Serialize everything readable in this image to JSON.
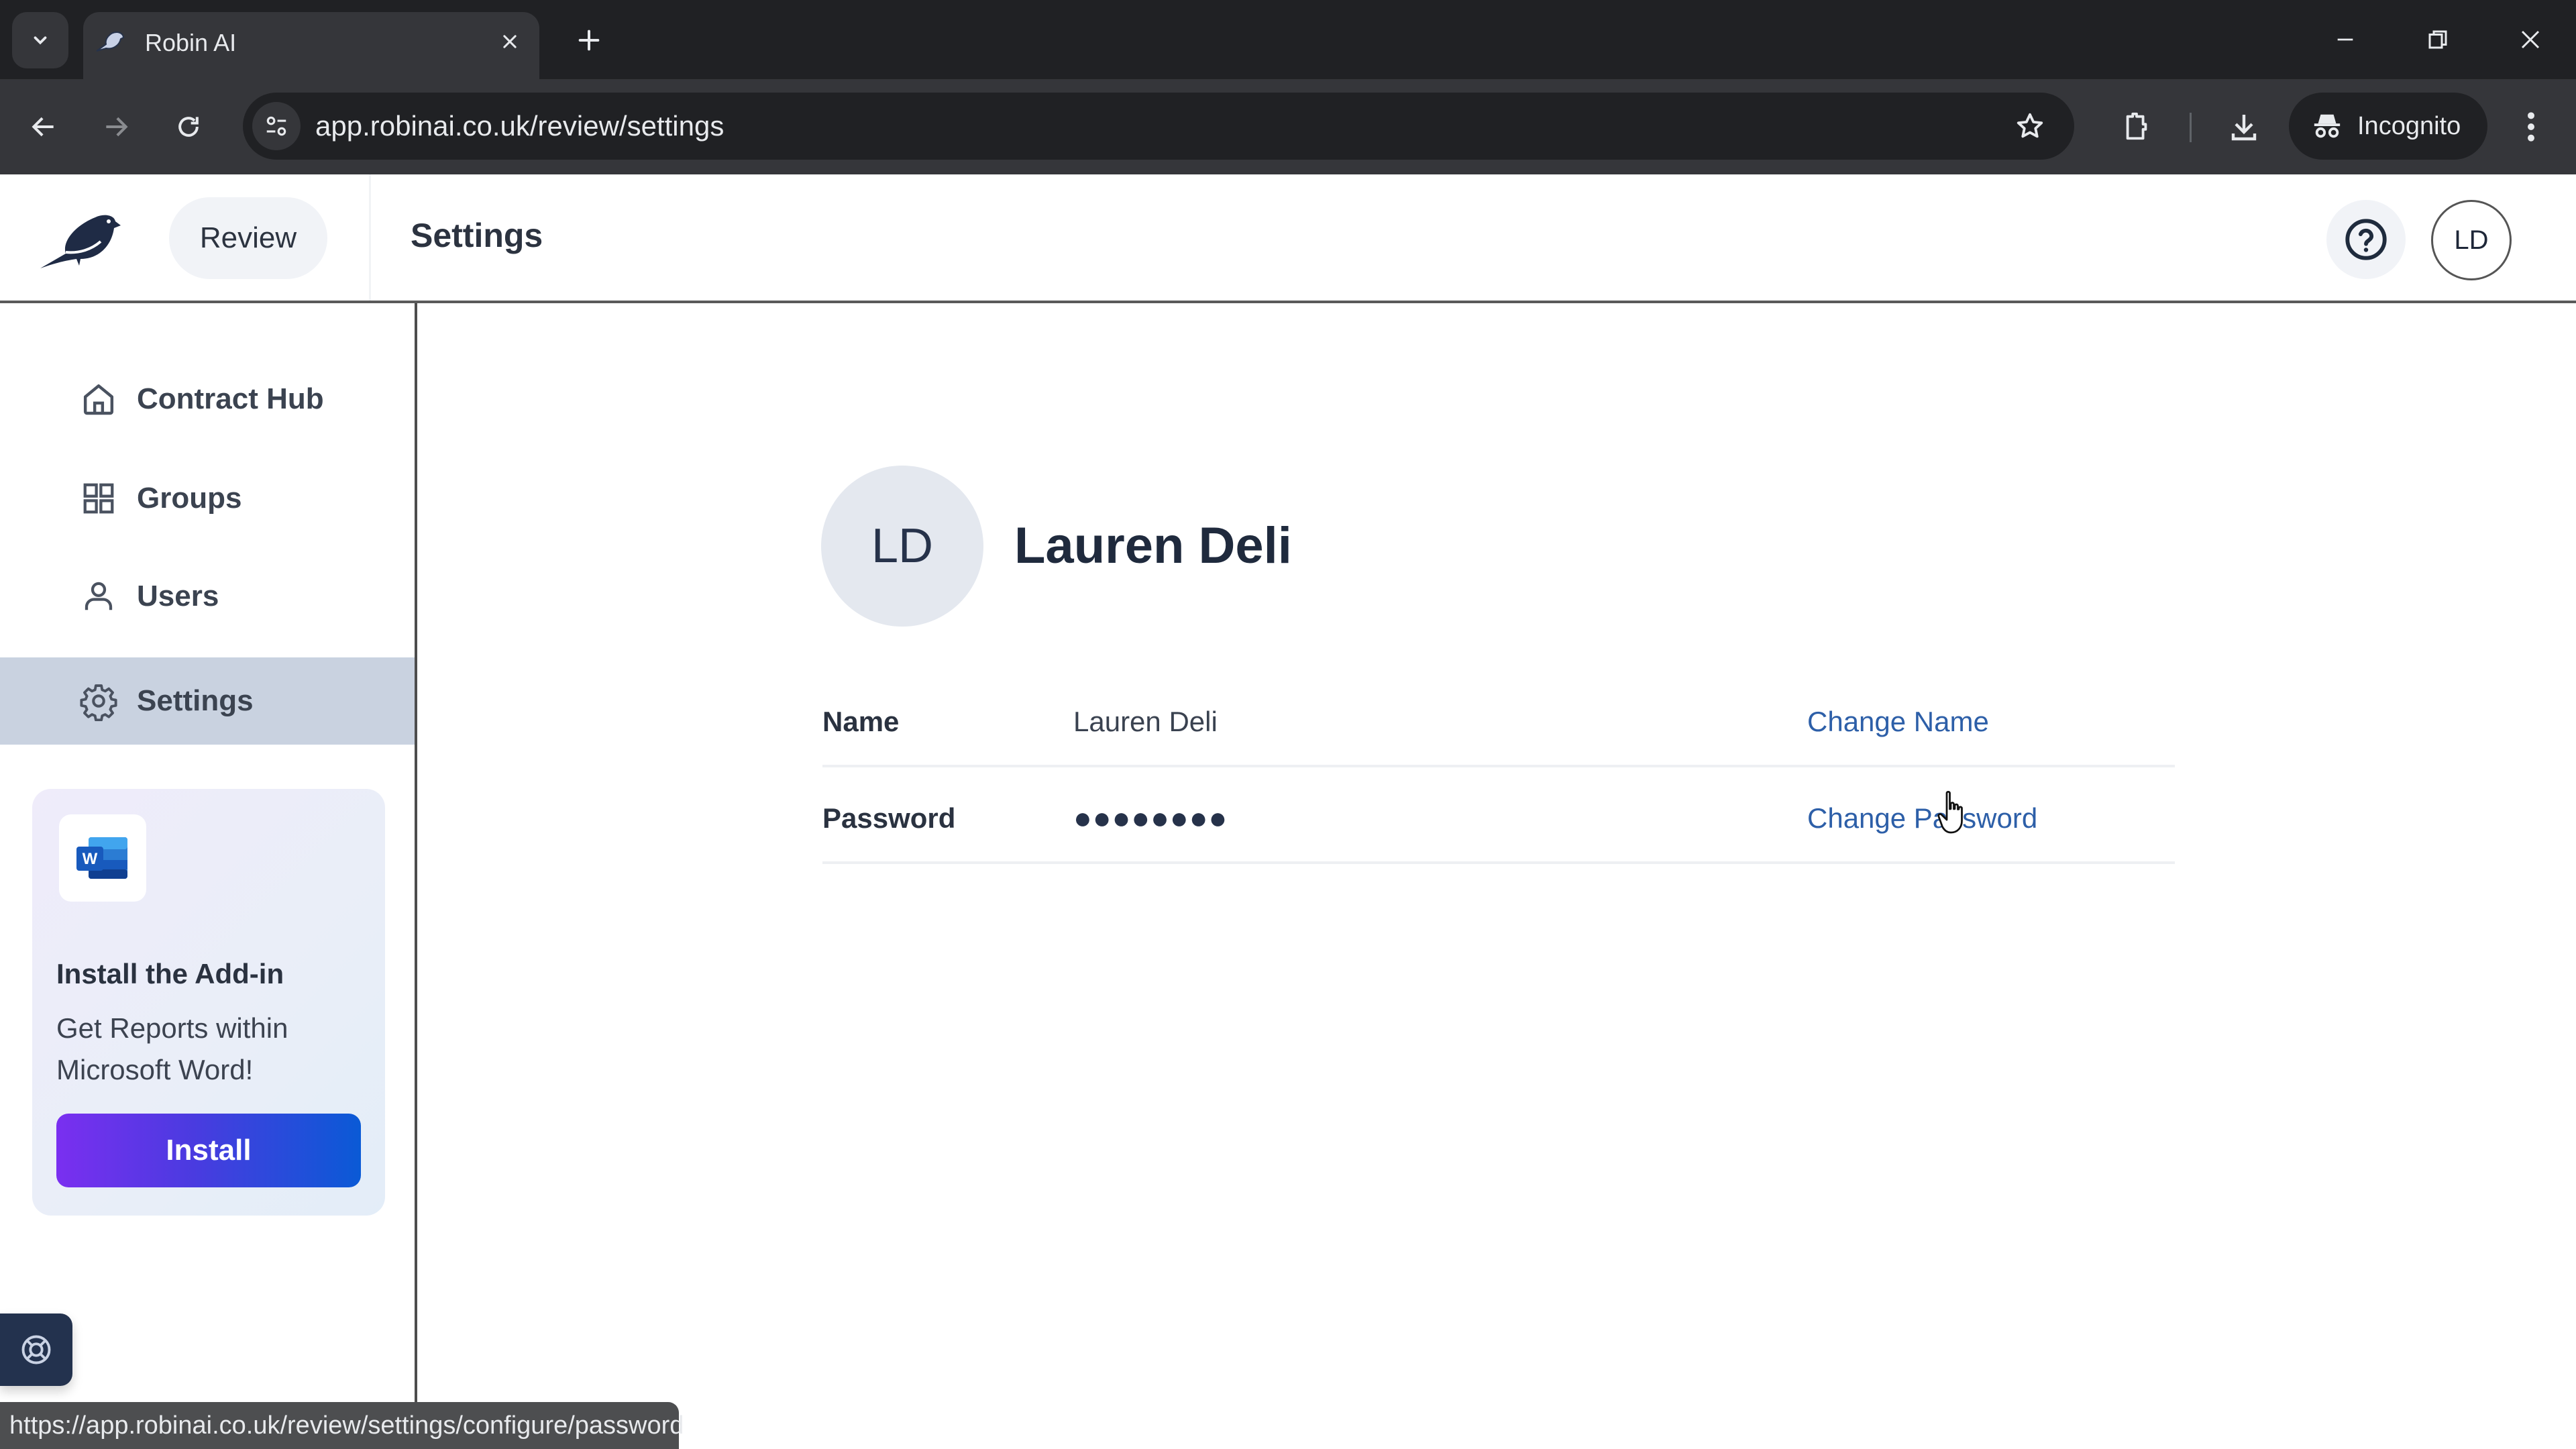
{
  "browser": {
    "tab_title": "Robin AI",
    "url": "app.robinai.co.uk/review/settings",
    "incognito_label": "Incognito",
    "status_url": "https://app.robinai.co.uk/review/settings/configure/password"
  },
  "header": {
    "review_label": "Review",
    "page_title": "Settings",
    "user_initials": "LD"
  },
  "sidebar": {
    "items": [
      {
        "label": "Contract Hub",
        "icon": "home-icon",
        "active": false
      },
      {
        "label": "Groups",
        "icon": "grid-icon",
        "active": false
      },
      {
        "label": "Users",
        "icon": "user-icon",
        "active": false
      },
      {
        "label": "Settings",
        "icon": "gear-icon",
        "active": true
      }
    ],
    "addin": {
      "title": "Install the Add-in",
      "description": "Get Reports within Microsoft Word!",
      "button_label": "Install",
      "word_letter": "W"
    }
  },
  "profile": {
    "initials": "LD",
    "full_name": "Lauren Deli"
  },
  "settings_rows": [
    {
      "label": "Name",
      "value": "Lauren Deli",
      "action": "Change Name"
    },
    {
      "label": "Password",
      "value": "●●●●●●●●",
      "action": "Change Password"
    }
  ],
  "colors": {
    "link": "#2d5fa8",
    "active_nav": "#c9d2e0",
    "brand_dark": "#23324e",
    "install_gradient_start": "#7a2ff0",
    "install_gradient_end": "#0a5ad6"
  }
}
